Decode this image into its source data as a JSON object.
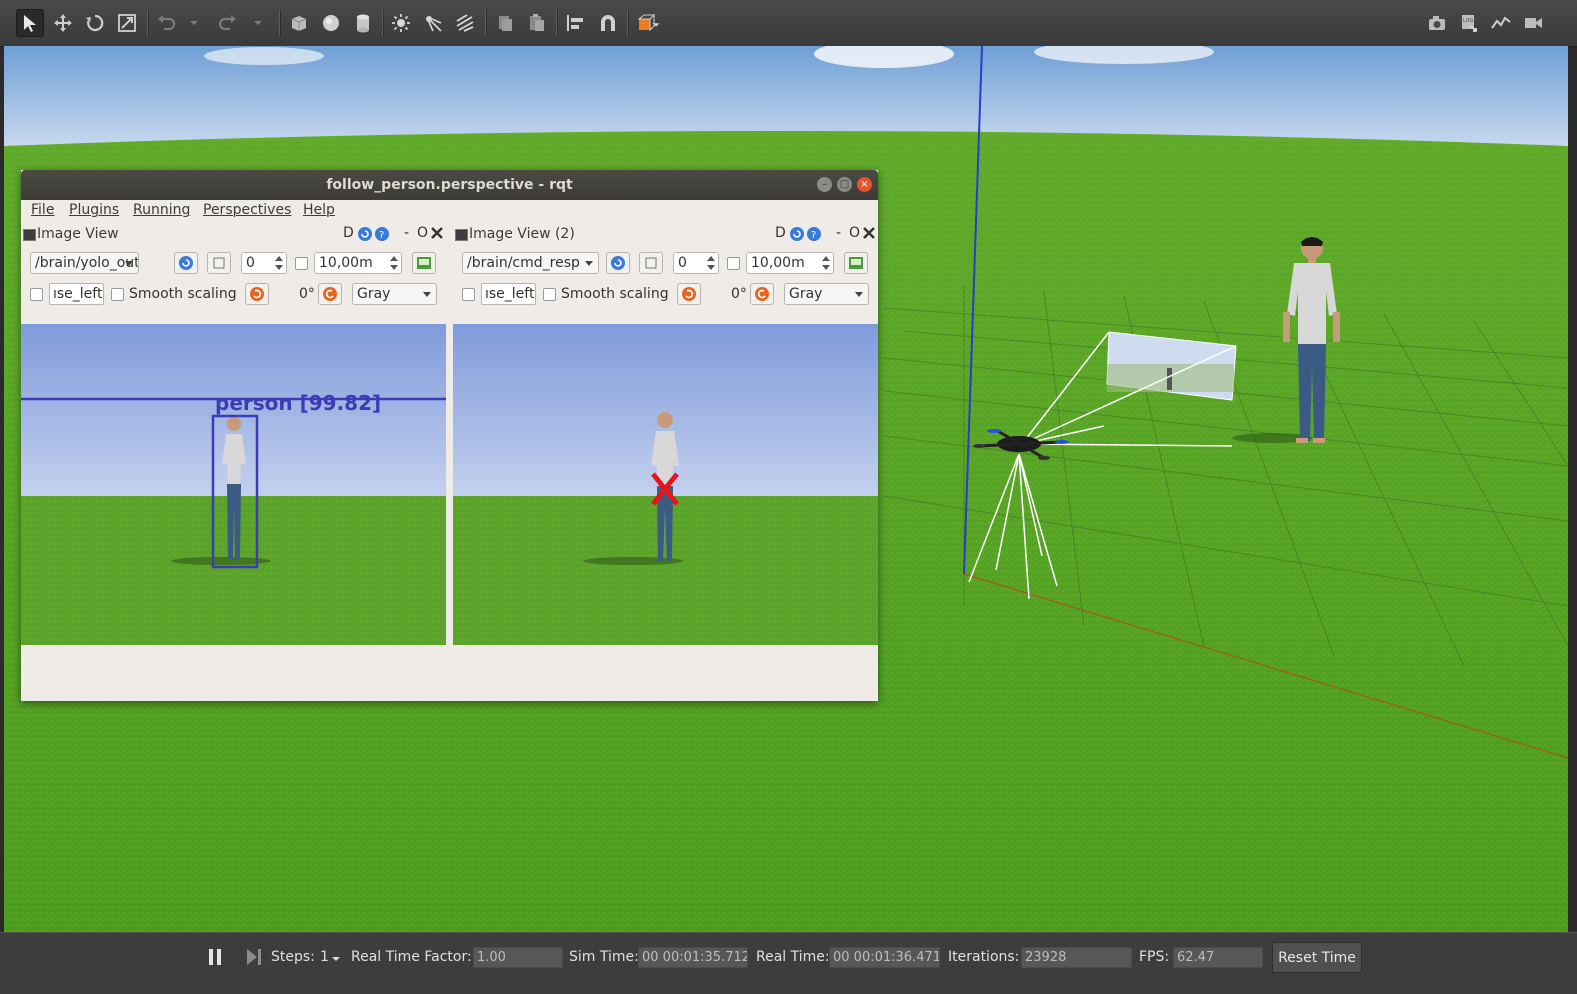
{
  "toolbar": {
    "tools": [
      "select-tool",
      "translate-tool",
      "rotate-tool",
      "scale-tool",
      "undo",
      "undo-history",
      "redo",
      "redo-history",
      "box-shape",
      "sphere-shape",
      "cylinder-shape",
      "point-light",
      "spot-light",
      "directional-light",
      "copy",
      "paste",
      "align",
      "snap",
      "view-angle"
    ],
    "right_tools": [
      "screenshot",
      "log",
      "plot",
      "record-video"
    ],
    "accent": "#f07a1c"
  },
  "rqt": {
    "title": "follow_person.perspective - rqt",
    "menu": [
      "File",
      "Plugins",
      "Running",
      "Perspectives",
      "Help"
    ],
    "panes": [
      {
        "title": "Image View",
        "topic": "/brain/yolo_outp",
        "spin_value": "0",
        "range": "10,00m",
        "mouse_topic": "ıse_left",
        "smooth_label": "Smooth scaling",
        "rotation": "0°",
        "color_scheme": "Gray",
        "detection_label": "person  [99.82]",
        "dock_label": "D",
        "minimize_label": "-",
        "float_label": "O"
      },
      {
        "title": "Image View (2)",
        "topic": "/brain/cmd_resp",
        "spin_value": "0",
        "range": "10,00m",
        "mouse_topic": "ıse_left",
        "smooth_label": "Smooth scaling",
        "rotation": "0°",
        "color_scheme": "Gray",
        "dock_label": "D",
        "minimize_label": "-",
        "float_label": "O"
      }
    ]
  },
  "bottom": {
    "steps_label": "Steps:",
    "steps_value": "1",
    "rtf_label": "Real Time Factor:",
    "rtf_value": "1.00",
    "sim_label": "Sim Time:",
    "sim_value": "00 00:01:35.712",
    "real_label": "Real Time:",
    "real_value": "00 00:01:36.471",
    "iter_label": "Iterations:",
    "iter_value": "23928",
    "fps_label": "FPS:",
    "fps_value": "62.47",
    "reset_label": "Reset Time"
  },
  "colors": {
    "grass": "#5fa82a",
    "sky": "#a9c1e8",
    "bbox": "#3c3cb4",
    "target_marker": "#e8141c"
  }
}
